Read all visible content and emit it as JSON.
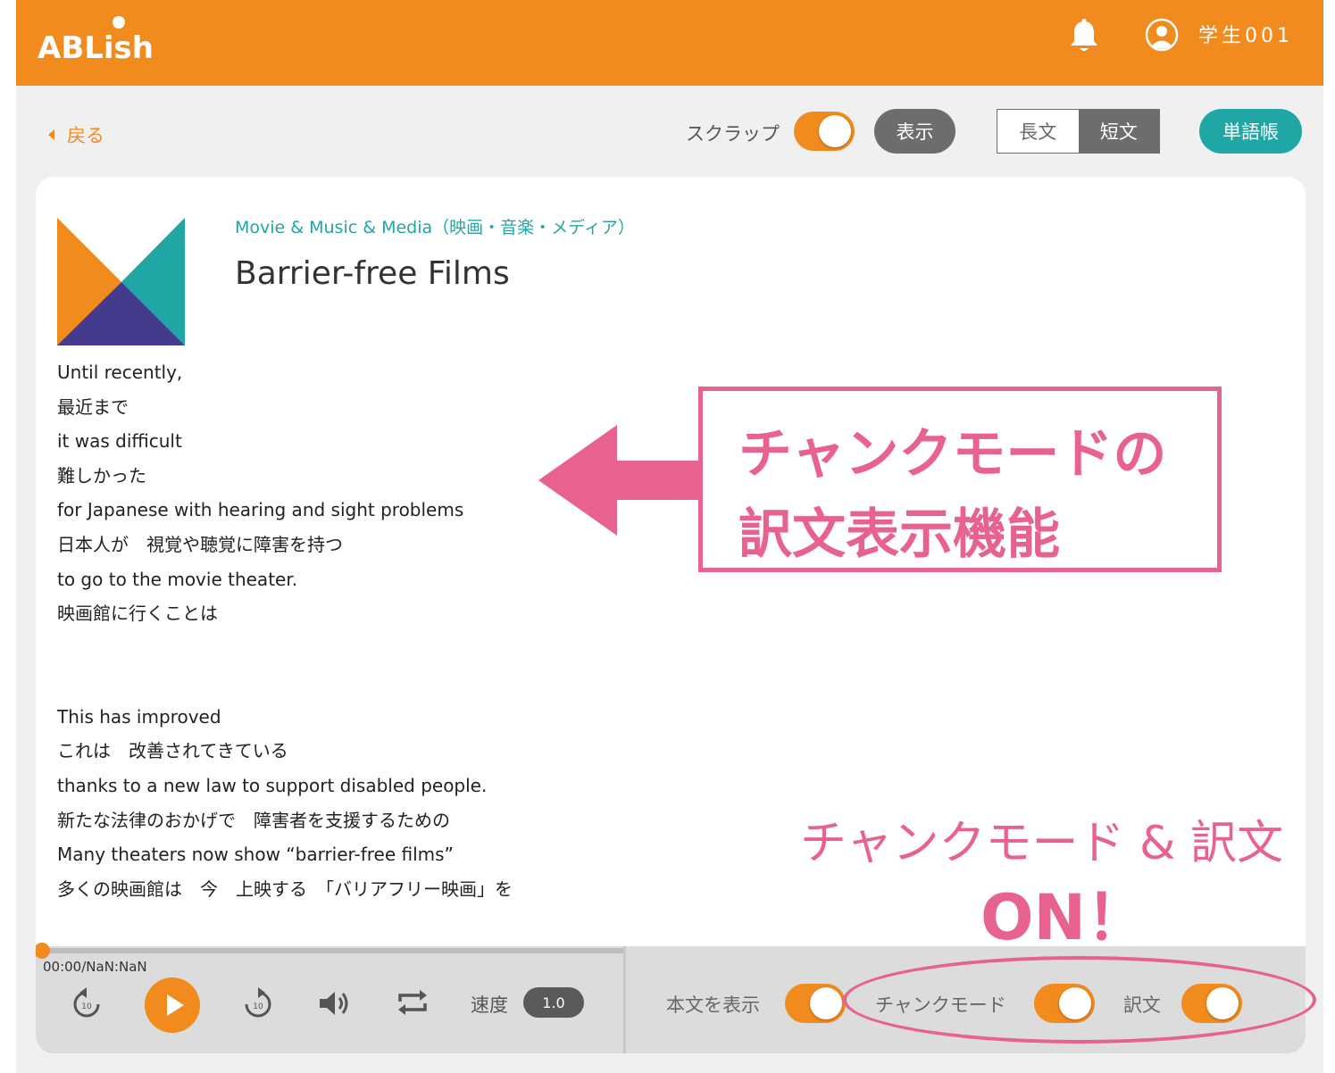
{
  "header": {
    "logo_text": "ABLish",
    "user_name": "学生001"
  },
  "toolbar": {
    "back_label": "戻る",
    "scrap_label": "スクラップ",
    "scrap_on": true,
    "show_button": "表示",
    "segments": [
      "長文",
      "短文"
    ],
    "segment_selected": "短文",
    "vocab_button": "単語帳"
  },
  "article": {
    "category": "Movie & Music & Media（映画・音楽・メディア）",
    "title": "Barrier-free Films",
    "paragraphs": [
      [
        "Until recently,",
        "最近まで",
        "it was difficult",
        "難しかった",
        "for Japanese with hearing and sight problems",
        "日本人が　視覚や聴覚に障害を持つ",
        "to go to the movie theater.",
        "映画館に行くことは"
      ],
      [
        "This has improved",
        "これは　改善されてきている",
        "thanks to a new law to support disabled people.",
        "新たな法律のおかげで　障害者を支援するための",
        "Many theaters now show “barrier-free films”",
        "多くの映画館は　今　上映する　「バリアフリー映画」を"
      ]
    ]
  },
  "player": {
    "time": "00:00/NaN:NaN",
    "progress": 0,
    "speed_label": "速度",
    "speed_value": "1.0",
    "show_text_label": "本文を表示",
    "show_text_on": true,
    "chunk_mode_label": "チャンクモード",
    "chunk_mode_on": true,
    "translation_label": "訳文",
    "translation_on": true
  },
  "annotations": {
    "box_line1": "チャンクモードの",
    "box_line2": "訳文表示機能",
    "bottom_line1": "チャンクモード & 訳文",
    "bottom_line2": "ON！"
  },
  "colors": {
    "brand_orange": "#f28b1e",
    "teal": "#21a6a6",
    "annotation_pink": "#e8628e"
  }
}
